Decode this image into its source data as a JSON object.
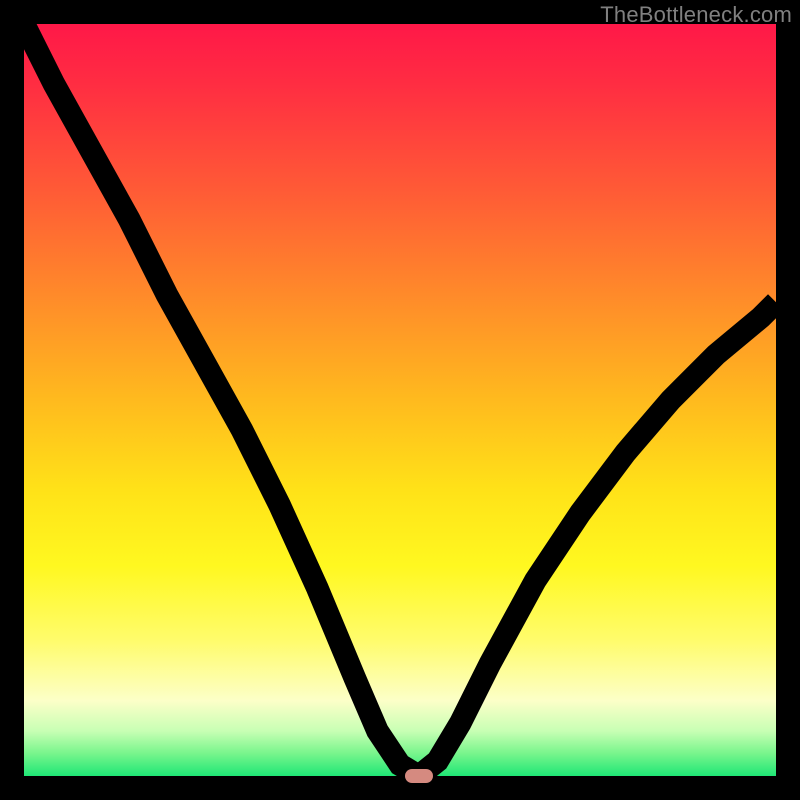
{
  "watermark": "TheBottleneck.com",
  "colors": {
    "curve": "#000000",
    "marker": "#d58a80",
    "watermark": "#808080"
  },
  "chart_data": {
    "type": "line",
    "title": "",
    "xlabel": "",
    "ylabel": "",
    "xlim": [
      0,
      100
    ],
    "ylim": [
      0,
      100
    ],
    "grid": false,
    "legend": false,
    "series": [
      {
        "name": "bottleneck-curve",
        "x": [
          0,
          4,
          9,
          14,
          19,
          24,
          29,
          34,
          39,
          44,
          47,
          50,
          52.5,
          55,
          58,
          62,
          68,
          74,
          80,
          86,
          92,
          98,
          100
        ],
        "y": [
          100,
          92,
          83,
          74,
          64,
          55,
          46,
          36,
          25,
          13,
          6,
          1.5,
          0,
          2,
          7,
          15,
          26,
          35,
          43,
          50,
          56,
          61,
          63
        ]
      }
    ],
    "marker": {
      "x": 52.5,
      "y": 0
    },
    "background_gradient": [
      {
        "stop": 0,
        "color": "#ff1848"
      },
      {
        "stop": 50,
        "color": "#ffe218"
      },
      {
        "stop": 90,
        "color": "#fcffc8"
      },
      {
        "stop": 100,
        "color": "#1fe676"
      }
    ]
  }
}
